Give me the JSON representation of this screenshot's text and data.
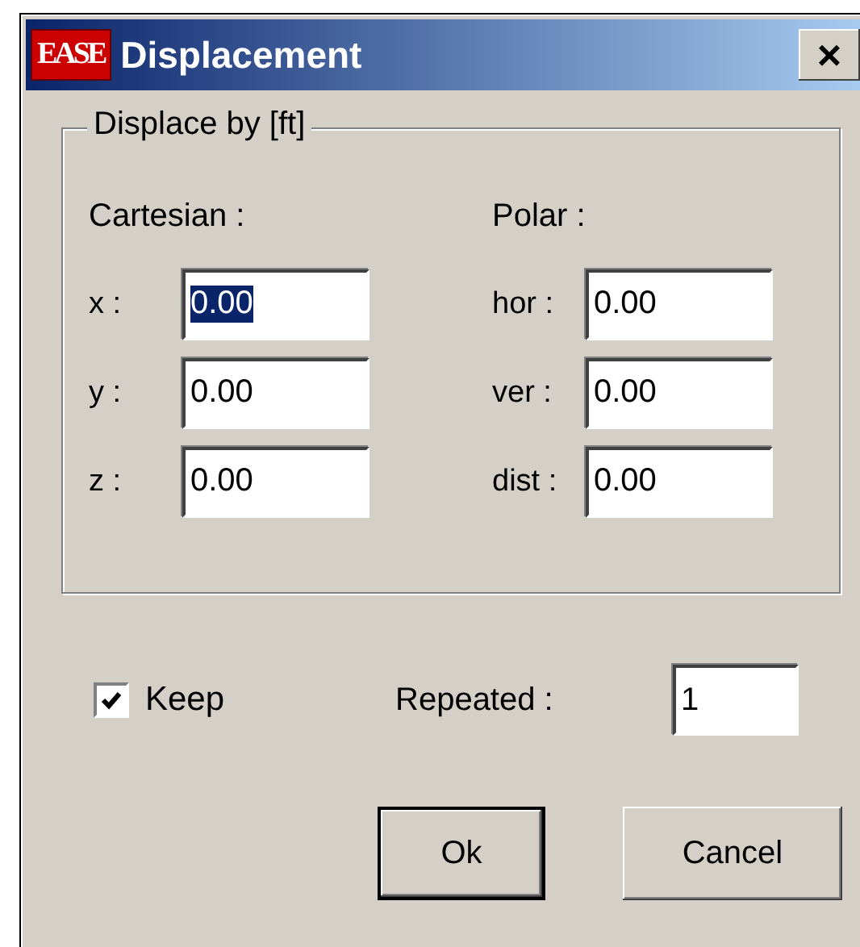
{
  "window": {
    "logo": "EASE",
    "title": "Displacement",
    "close": "×"
  },
  "group": {
    "title": "Displace by [ft]",
    "columns": [
      {
        "heading": "Cartesian :",
        "fields": [
          {
            "label": "x :",
            "value": "0.00",
            "selected": true
          },
          {
            "label": "y :",
            "value": "0.00",
            "selected": false
          },
          {
            "label": "z :",
            "value": "0.00",
            "selected": false
          }
        ]
      },
      {
        "heading": "Polar :",
        "fields": [
          {
            "label": "hor :",
            "value": "0.00",
            "selected": false
          },
          {
            "label": "ver :",
            "value": "0.00",
            "selected": false
          },
          {
            "label": "dist :",
            "value": "0.00",
            "selected": false
          }
        ]
      }
    ]
  },
  "keep": {
    "label": "Keep",
    "checked": true
  },
  "repeated": {
    "label": "Repeated :",
    "value": "1"
  },
  "buttons": [
    {
      "label": "Ok",
      "default": true
    },
    {
      "label": "Cancel",
      "default": false
    }
  ]
}
